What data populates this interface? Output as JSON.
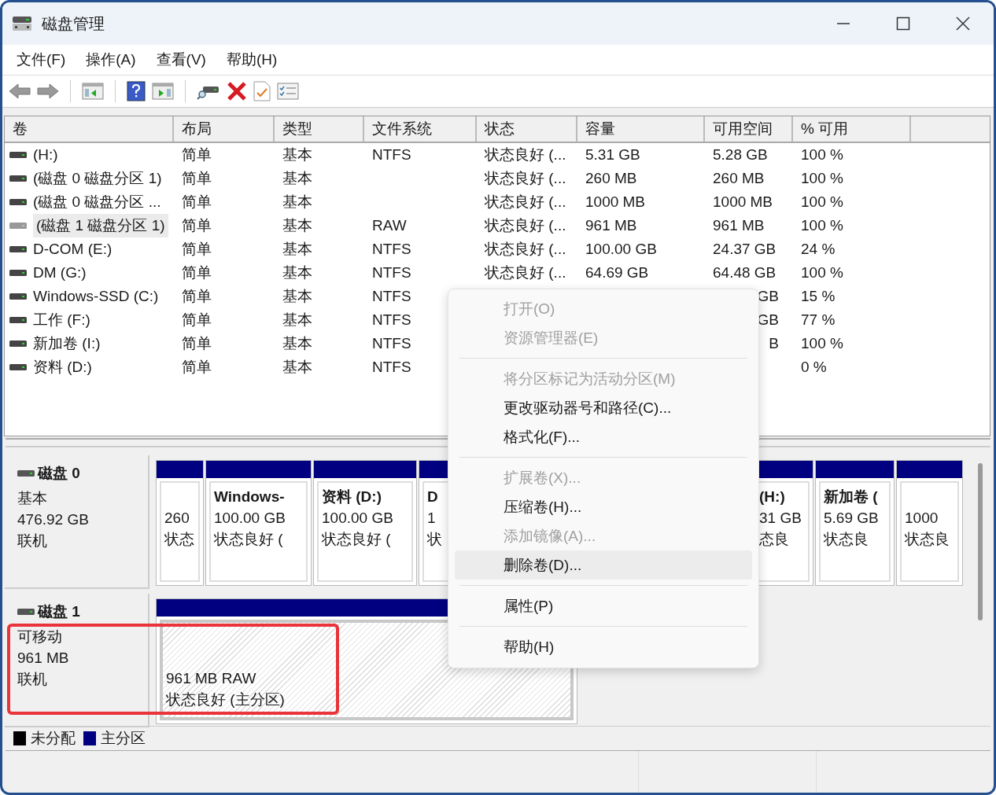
{
  "window": {
    "title": "磁盘管理"
  },
  "menu_bar": [
    "文件(F)",
    "操作(A)",
    "查看(V)",
    "帮助(H)"
  ],
  "volume_table": {
    "columns": [
      "卷",
      "布局",
      "类型",
      "文件系统",
      "状态",
      "容量",
      "可用空间",
      "% 可用"
    ],
    "rows": [
      {
        "cells": [
          "(H:)",
          "简单",
          "基本",
          "NTFS",
          "状态良好 (...",
          "5.31 GB",
          "5.28 GB",
          "100 %"
        ],
        "selected": false
      },
      {
        "cells": [
          "(磁盘 0 磁盘分区 1)",
          "简单",
          "基本",
          "",
          "状态良好 (...",
          "260 MB",
          "260 MB",
          "100 %"
        ],
        "selected": false
      },
      {
        "cells": [
          "(磁盘 0 磁盘分区 ...",
          "简单",
          "基本",
          "",
          "状态良好 (...",
          "1000 MB",
          "1000 MB",
          "100 %"
        ],
        "selected": false
      },
      {
        "cells": [
          "(磁盘 1 磁盘分区 1)",
          "简单",
          "基本",
          "RAW",
          "状态良好 (...",
          "961 MB",
          "961 MB",
          "100 %"
        ],
        "selected": true
      },
      {
        "cells": [
          "D-COM (E:)",
          "简单",
          "基本",
          "NTFS",
          "状态良好 (...",
          "100.00 GB",
          "24.37 GB",
          "24 %"
        ],
        "selected": false
      },
      {
        "cells": [
          "DM (G:)",
          "简单",
          "基本",
          "NTFS",
          "状态良好 (...",
          "64.69 GB",
          "64.48 GB",
          "100 %"
        ],
        "selected": false
      },
      {
        "cells": [
          "Windows-SSD (C:)",
          "简单",
          "基本",
          "NTFS",
          "",
          "",
          "GB",
          "15 %"
        ],
        "selected": false
      },
      {
        "cells": [
          "工作 (F:)",
          "简单",
          "基本",
          "NTFS",
          "",
          "",
          "GB",
          "77 %"
        ],
        "selected": false
      },
      {
        "cells": [
          "新加卷 (I:)",
          "简单",
          "基本",
          "NTFS",
          "",
          "",
          "B",
          "100 %"
        ],
        "selected": false
      },
      {
        "cells": [
          "资料 (D:)",
          "简单",
          "基本",
          "NTFS",
          "",
          "",
          "",
          "0 %"
        ],
        "selected": false
      }
    ]
  },
  "disks": [
    {
      "name": "磁盘 0",
      "type": "基本",
      "size": "476.92 GB",
      "status": "联机",
      "partitions": [
        {
          "lines": [
            "260",
            "状态"
          ],
          "selected": false
        },
        {
          "title": "Windows-",
          "lines": [
            "100.00 GB",
            "状态良好 ("
          ],
          "selected": false
        },
        {
          "title": "资料 (D:)",
          "lines": [
            "100.00 GB",
            "状态良好 ("
          ],
          "selected": false
        },
        {
          "title": "D",
          "lines": [
            "1",
            "状"
          ],
          "selected": false
        },
        {
          "title": "(H:)",
          "lines": [
            "31 GB",
            "态良"
          ],
          "selected": false
        },
        {
          "title": "新加卷 (",
          "lines": [
            "5.69 GB",
            "状态良"
          ],
          "selected": false
        },
        {
          "lines": [
            "1000",
            "状态良"
          ],
          "selected": false
        }
      ]
    },
    {
      "name": "磁盘 1",
      "type": "可移动",
      "size": "961 MB",
      "status": "联机",
      "partitions": [
        {
          "lines": [
            "961 MB RAW",
            "状态良好 (主分区)"
          ],
          "selected": true
        }
      ]
    }
  ],
  "legend": [
    {
      "label": "未分配",
      "color": "#000000"
    },
    {
      "label": "主分区",
      "color": "#000080"
    }
  ],
  "context_menu": {
    "items": [
      {
        "kind": "item",
        "label": "打开(O)",
        "disabled": true,
        "selected": false
      },
      {
        "kind": "item",
        "label": "资源管理器(E)",
        "disabled": true,
        "selected": false
      },
      {
        "kind": "separator"
      },
      {
        "kind": "item",
        "label": "将分区标记为活动分区(M)",
        "disabled": true,
        "selected": false
      },
      {
        "kind": "item",
        "label": "更改驱动器号和路径(C)...",
        "disabled": false,
        "selected": false
      },
      {
        "kind": "item",
        "label": "格式化(F)...",
        "disabled": false,
        "selected": false
      },
      {
        "kind": "separator"
      },
      {
        "kind": "item",
        "label": "扩展卷(X)...",
        "disabled": true,
        "selected": false
      },
      {
        "kind": "item",
        "label": "压缩卷(H)...",
        "disabled": false,
        "selected": false
      },
      {
        "kind": "item",
        "label": "添加镜像(A)...",
        "disabled": true,
        "selected": false
      },
      {
        "kind": "item",
        "label": "删除卷(D)...",
        "disabled": false,
        "selected": true
      },
      {
        "kind": "separator"
      },
      {
        "kind": "item",
        "label": "属性(P)",
        "disabled": false,
        "selected": false
      },
      {
        "kind": "separator"
      },
      {
        "kind": "item",
        "label": "帮助(H)",
        "disabled": false,
        "selected": false
      }
    ]
  }
}
